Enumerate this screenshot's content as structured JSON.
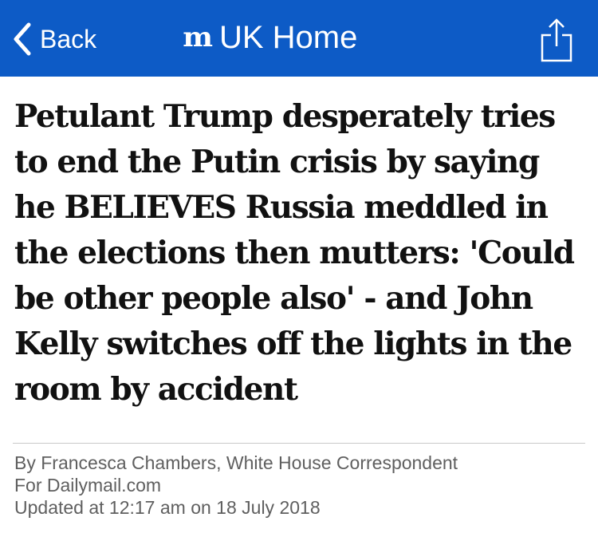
{
  "nav": {
    "back_label": "Back",
    "home_label": "UK Home",
    "logo_text": "m",
    "background_color": "#0d5bc6",
    "back_icon": "chevron-left-icon",
    "share_icon": "share-icon"
  },
  "article": {
    "headline": "Petulant Trump desperately tries to end the Putin crisis by saying he BELIEVES Russia meddled in the elections then mutters: 'Could be other people also' - and John Kelly switches off the lights in the room by accident",
    "byline_line1": "By Francesca Chambers, White House Correspondent",
    "byline_line2": "For Dailymail.com",
    "updated": "Updated at 12:17 am on 18 July 2018"
  }
}
